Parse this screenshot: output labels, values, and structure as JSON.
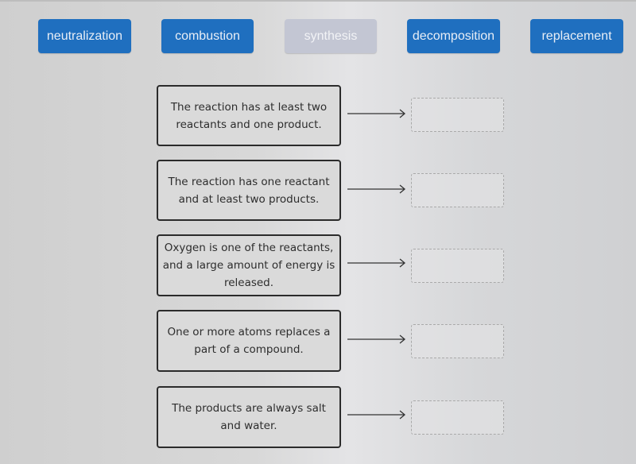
{
  "answer_tiles": [
    {
      "label": "neutralization",
      "state": "available"
    },
    {
      "label": "combustion",
      "state": "available"
    },
    {
      "label": "synthesis",
      "state": "used"
    },
    {
      "label": "decomposition",
      "state": "available"
    },
    {
      "label": "replacement",
      "state": "available"
    }
  ],
  "prompts": [
    {
      "text": "The reaction has at least two reactants and one product.",
      "answer": ""
    },
    {
      "text": "The reaction has one reactant and at least two products.",
      "answer": ""
    },
    {
      "text": "Oxygen is one of the reactants, and a large amount of energy is released.",
      "answer": ""
    },
    {
      "text": "One or more atoms replaces a part of a compound.",
      "answer": ""
    },
    {
      "text": "The products are always salt and water.",
      "answer": ""
    }
  ],
  "icons": {
    "arrow": "right-arrow-icon"
  },
  "colors": {
    "tile": "#1f6fbf",
    "tile_used": "#c3c6d3"
  }
}
